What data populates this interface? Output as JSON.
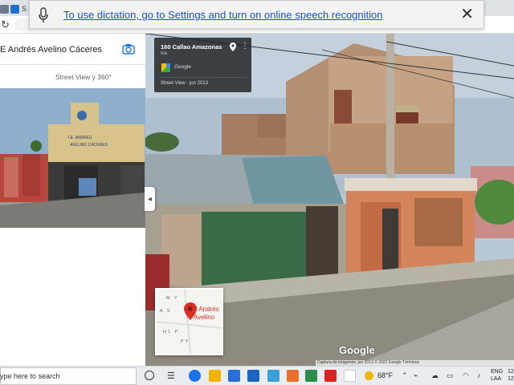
{
  "browser": {
    "tabs": [
      {
        "label": "",
        "icon": "page-icon"
      },
      {
        "label": "S",
        "icon": "maps-icon"
      }
    ]
  },
  "notification": {
    "message": "To use dictation, go to Settings and turn on online speech recognition",
    "icon": "microphone-icon",
    "close_icon": "close-icon"
  },
  "sidepanel": {
    "place_title": "E Andrés Avelino Cáceres",
    "street_view_label": "Street View y 360°",
    "thumb_sign_line1": "I.E. ANDRÉS",
    "thumb_sign_line2": "AVELINO CÁCERES"
  },
  "streetview": {
    "info_card": {
      "address": "160 Callao Amazonas",
      "locality": "Ica",
      "source": "Google",
      "date": "Street View - jun 2013"
    },
    "minimap": {
      "label_line1": "IE Andrés",
      "label_line2": "Avelino"
    },
    "logo": "Google",
    "attribution": "Captura de imágenes: jun 2013   © 2022 Google   Términos"
  },
  "taskbar": {
    "search_placeholder": "Type here to search",
    "weather_temp": "68°F",
    "language_line1": "ENG",
    "language_line2": "LAA",
    "clock_line1": "12",
    "clock_line2": "12"
  },
  "colors": {
    "accent_link": "#1a4fcf",
    "taskbar_bg": "#e9ecf0",
    "pin_red": "#d93025"
  }
}
